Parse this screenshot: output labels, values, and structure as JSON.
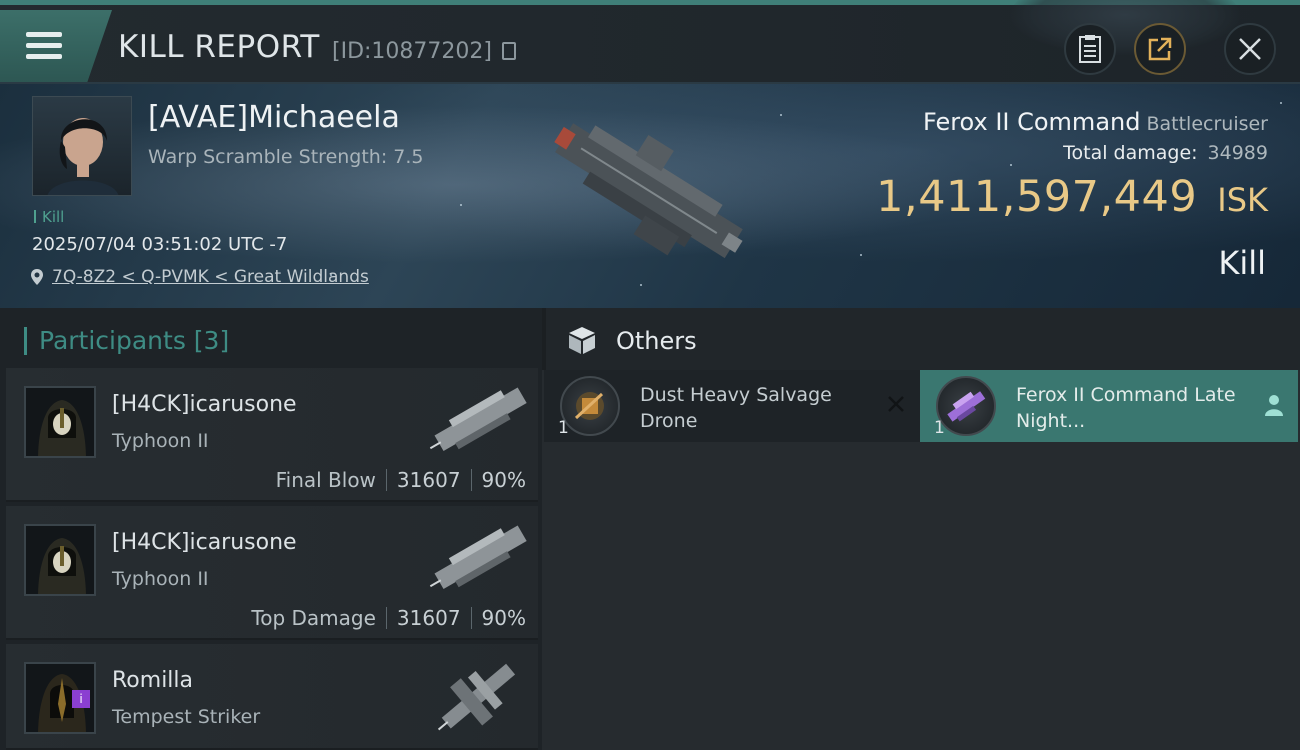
{
  "header": {
    "title": "KILL REPORT",
    "report_id": "[ID:10877202]"
  },
  "victim": {
    "name": "[AVAE]Michaeela",
    "warp_scramble": "Warp Scramble Strength: 7.5",
    "tag": "Kill",
    "timestamp": "2025/07/04 03:51:02 UTC -7",
    "location": "7Q-8Z2 < Q-PVMK < Great Wildlands",
    "ship_name": "Ferox II Command",
    "ship_class": "Battlecruiser",
    "total_damage_label": "Total damage:",
    "total_damage": "34989",
    "isk_value": "1,411,597,449",
    "isk_unit": "ISK",
    "result": "Kill"
  },
  "participants": {
    "header": "Participants [3]",
    "rows": [
      {
        "name": "[H4CK]icarusone",
        "ship": "Typhoon II",
        "label": "Final Blow",
        "damage": "31607",
        "percent": "90%"
      },
      {
        "name": "[H4CK]icarusone",
        "ship": "Typhoon II",
        "label": "Top Damage",
        "damage": "31607",
        "percent": "90%"
      },
      {
        "name": "Romilla",
        "ship": "Tempest Striker"
      }
    ]
  },
  "others": {
    "title": "Others",
    "items": [
      {
        "qty": "1",
        "name": "Dust Heavy Salvage Drone"
      },
      {
        "qty": "1",
        "name": "Ferox II Command Late Night..."
      }
    ]
  },
  "colors": {
    "accent_teal": "#3e8c84",
    "isk_gold": "#e9c987",
    "selected_card": "#3a7770"
  },
  "icons": [
    "menu-icon",
    "copy-icon",
    "clipboard-icon",
    "share-icon",
    "close-icon",
    "location-pin-icon",
    "cube-icon",
    "x-icon",
    "person-icon"
  ]
}
